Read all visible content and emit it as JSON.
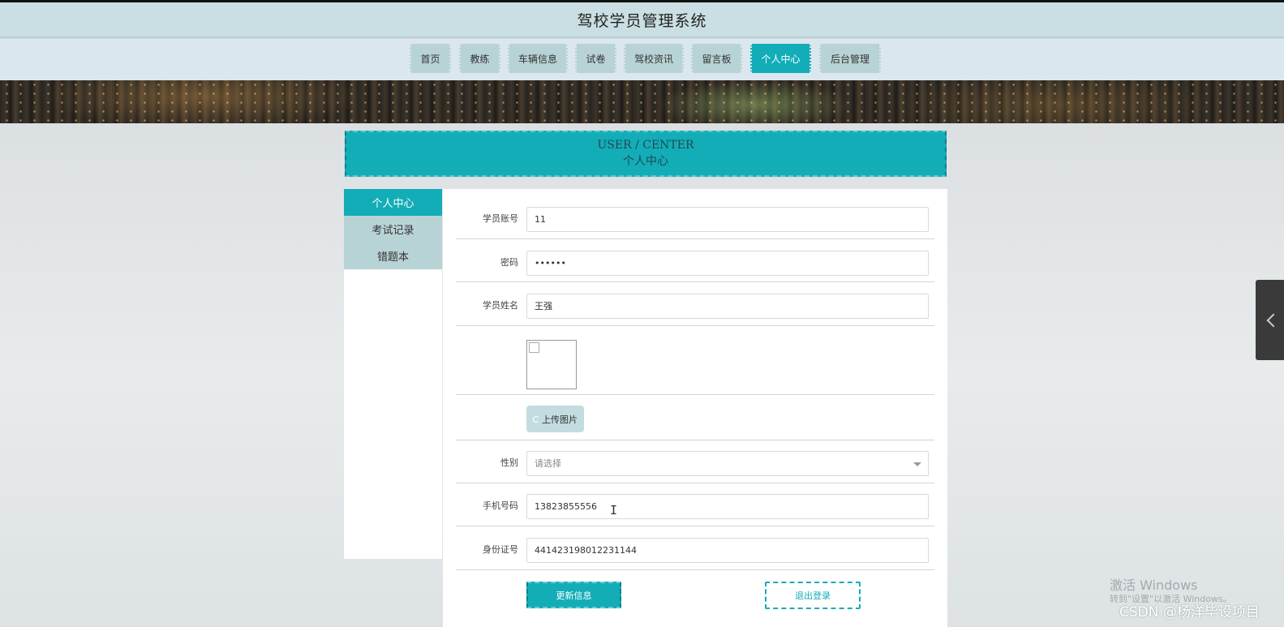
{
  "app": {
    "title": "驾校学员管理系统"
  },
  "nav": {
    "items": [
      {
        "label": "首页",
        "active": false
      },
      {
        "label": "教练",
        "active": false
      },
      {
        "label": "车辆信息",
        "active": false
      },
      {
        "label": "试卷",
        "active": false
      },
      {
        "label": "驾校资讯",
        "active": false
      },
      {
        "label": "留言板",
        "active": false
      },
      {
        "label": "个人中心",
        "active": true
      },
      {
        "label": "后台管理",
        "active": false
      }
    ]
  },
  "user_center": {
    "title_en": "USER / CENTER",
    "title_cn": "个人中心"
  },
  "sidebar": {
    "items": [
      {
        "label": "个人中心",
        "active": true
      },
      {
        "label": "考试记录",
        "active": false
      },
      {
        "label": "错题本",
        "active": false
      }
    ]
  },
  "form": {
    "account": {
      "label": "学员账号",
      "value": "11"
    },
    "password": {
      "label": "密码",
      "value": "••••••"
    },
    "name": {
      "label": "学员姓名",
      "value": "王强"
    },
    "upload": {
      "label": "上传图片"
    },
    "gender": {
      "label": "性别",
      "placeholder": "请选择"
    },
    "phone": {
      "label": "手机号码",
      "value": "13823855556"
    },
    "id_card": {
      "label": "身份证号",
      "value": "441423198012231144"
    },
    "update_button": "更新信息",
    "logout_button": "退出登录"
  },
  "watermark": {
    "line1": "激活 Windows",
    "line2": "转到\"设置\"以激活 Windows。",
    "csdn": "CSDN @杨洋毕设项目"
  },
  "colors": {
    "accent": "#13adb8",
    "nav_bg": "#dbe7ee",
    "nav_item": "#b8d3d5",
    "title_bar": "#c9dfe3"
  }
}
